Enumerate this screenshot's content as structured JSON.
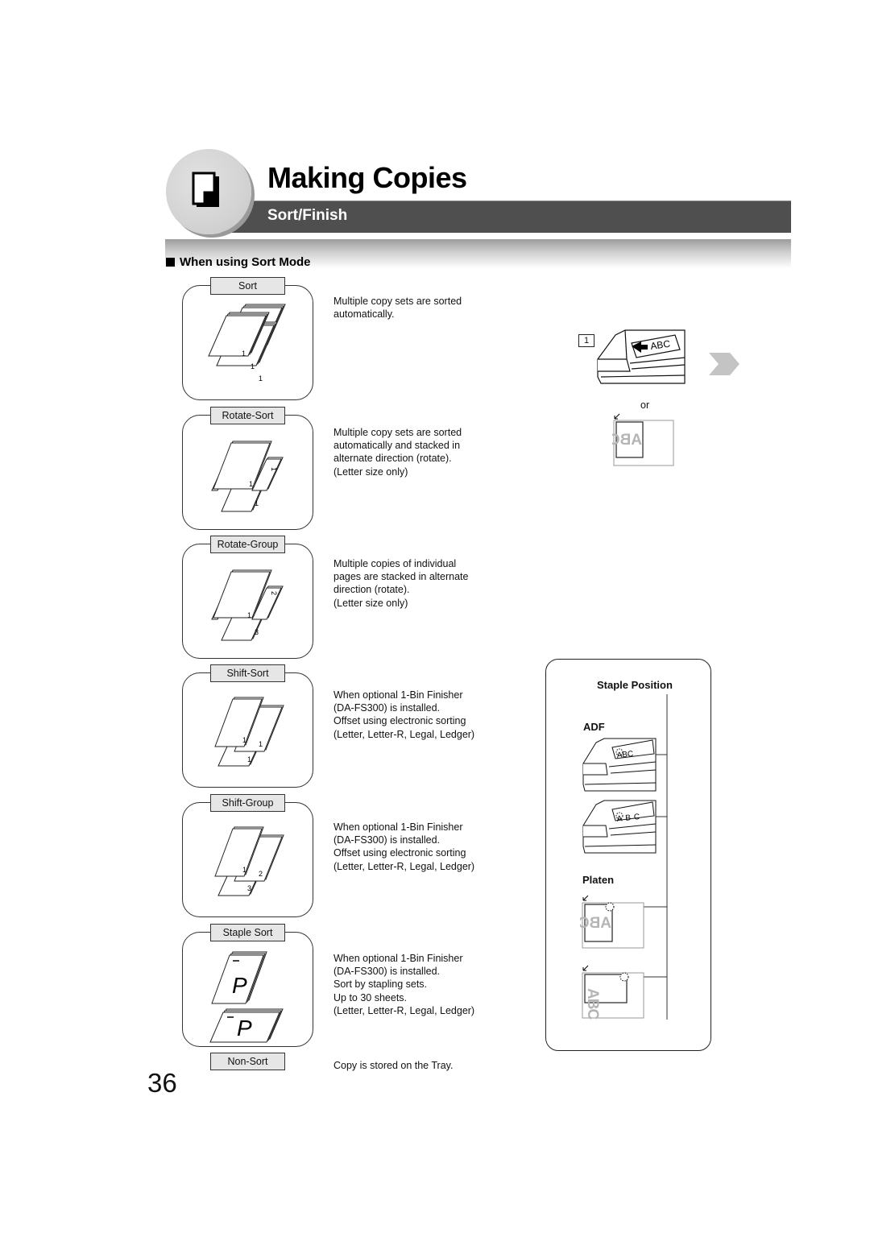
{
  "header": {
    "title": "Making Copies",
    "subtitle": "Sort/Finish",
    "icon": "copy-document-icon"
  },
  "section": {
    "heading": "When using Sort Mode"
  },
  "modes": [
    {
      "label": "Sort",
      "description": [
        "Multiple copy sets are sorted",
        "automatically."
      ],
      "page_numbers": [
        "1",
        "1",
        "1"
      ]
    },
    {
      "label": "Rotate-Sort",
      "description": [
        "Multiple copy sets are sorted",
        "automatically and stacked in",
        "alternate direction (rotate).",
        "(Letter size only)"
      ],
      "page_numbers": [
        "1",
        "1",
        "1"
      ]
    },
    {
      "label": "Rotate-Group",
      "description": [
        "Multiple copies of individual",
        "pages are stacked in alternate",
        "direction (rotate).",
        "(Letter size only)"
      ],
      "page_numbers": [
        "1",
        "2",
        "3"
      ]
    },
    {
      "label": "Shift-Sort",
      "description": [
        "When optional 1-Bin Finisher",
        "(DA-FS300) is installed.",
        "Offset using electronic sorting",
        "(Letter, Letter-R, Legal, Ledger)"
      ],
      "page_numbers": [
        "1",
        "1",
        "1"
      ]
    },
    {
      "label": "Shift-Group",
      "description": [
        "When optional 1-Bin Finisher",
        "(DA-FS300) is installed.",
        "Offset using electronic sorting",
        "(Letter, Letter-R, Legal, Ledger)"
      ],
      "page_numbers": [
        "1",
        "2",
        "3"
      ]
    },
    {
      "label": "Staple Sort",
      "description": [
        "When optional 1-Bin Finisher",
        "(DA-FS300) is installed.",
        "Sort by stapling sets.",
        "Up to 30 sheets.",
        "(Letter, Letter-R, Legal, Ledger)"
      ],
      "page_letters": [
        "P",
        "P"
      ]
    },
    {
      "label": "Non-Sort",
      "description": [
        "Copy is stored on the Tray."
      ]
    }
  ],
  "step": {
    "number": "1",
    "adf_text": "ABC",
    "or_label": "or",
    "platen_text": "ABC"
  },
  "staple_position": {
    "title": "Staple Position",
    "adf_label": "ADF",
    "platen_label": "Platen",
    "sample_text": "ABC"
  },
  "page_number": "36",
  "colors": {
    "subbar": "#4f4f4f",
    "circle": "#d3d3d3",
    "label_fill": "#e6e6e6",
    "ghost_text": "#b5b5b5",
    "next_arrow": "#c4c4c4"
  }
}
